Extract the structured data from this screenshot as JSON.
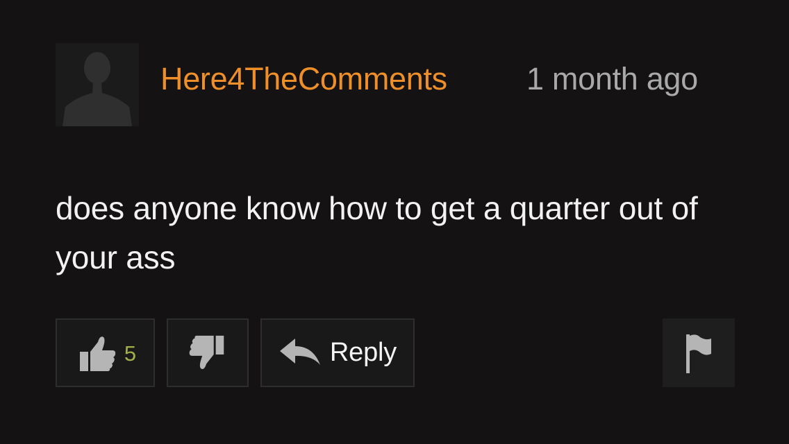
{
  "comment": {
    "username": "Here4TheComments",
    "timestamp": "1 month ago",
    "text": "does anyone know how to get a quarter out of your ass",
    "likes": "5"
  },
  "actions": {
    "reply_label": "Reply"
  },
  "colors": {
    "background": "#141212",
    "username": "#ee8f2a",
    "timestamp": "#a9a9a9",
    "like_count": "#a3b04a",
    "icon": "#b5b5b5"
  },
  "icons": {
    "avatar": "default-user-silhouette",
    "like": "thumbs-up-icon",
    "dislike": "thumbs-down-icon",
    "reply": "reply-arrow-icon",
    "flag": "flag-icon"
  }
}
